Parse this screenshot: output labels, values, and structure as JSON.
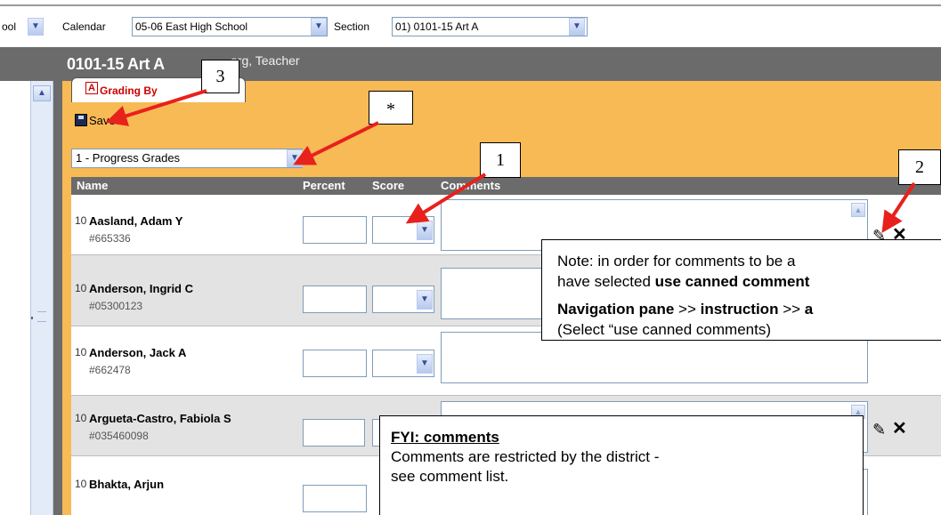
{
  "topbar": {
    "school_fragment": "ool",
    "calendar_label": "Calendar",
    "calendar_value": "05-06 East High School",
    "section_label": "Section",
    "section_value": "01) 0101-15 Art A"
  },
  "header": {
    "course_title": "0101-15 Art A",
    "teacher": "erg, Teacher"
  },
  "tab": {
    "label": "Grading By"
  },
  "toolbar": {
    "save_label": "Save"
  },
  "grading_task": {
    "selected": "1 - Progress Grades"
  },
  "grid": {
    "columns": {
      "name": "Name",
      "percent": "Percent",
      "score": "Score",
      "comments": "Comments"
    },
    "rows": [
      {
        "num": "10",
        "name": "Aasland, Adam Y",
        "id": "#665336"
      },
      {
        "num": "10",
        "name": "Anderson, Ingrid C",
        "id": "#05300123"
      },
      {
        "num": "10",
        "name": "Anderson, Jack A",
        "id": "#662478"
      },
      {
        "num": "10",
        "name": "Argueta-Castro, Fabiola S",
        "id": "#035460098"
      },
      {
        "num": "10",
        "name": "Bhakta, Arjun",
        "id": ""
      }
    ]
  },
  "annotations": {
    "callout_1": "1",
    "callout_2": "2",
    "callout_3": "3",
    "callout_star": "*",
    "note": {
      "line1": "Note: in order for comments to be a",
      "line2_prefix": "have selected ",
      "line2_bold": "use canned comment",
      "line3_nav": "Navigation pane",
      "line3_sep1": " >> ",
      "line3_instr": "instruction",
      "line3_sep2": " >> ",
      "line3_tail": "a",
      "line4": "(Select “use canned comments)"
    },
    "fyi": {
      "title": "FYI: comments",
      "line1": "Comments are restricted by the district  -",
      "line2": "see comment list."
    }
  },
  "colors": {
    "panel_orange": "#f7ba55",
    "header_gray": "#6b6b6b",
    "arrow_red": "#e8211c",
    "tab_red": "#cc0000"
  }
}
